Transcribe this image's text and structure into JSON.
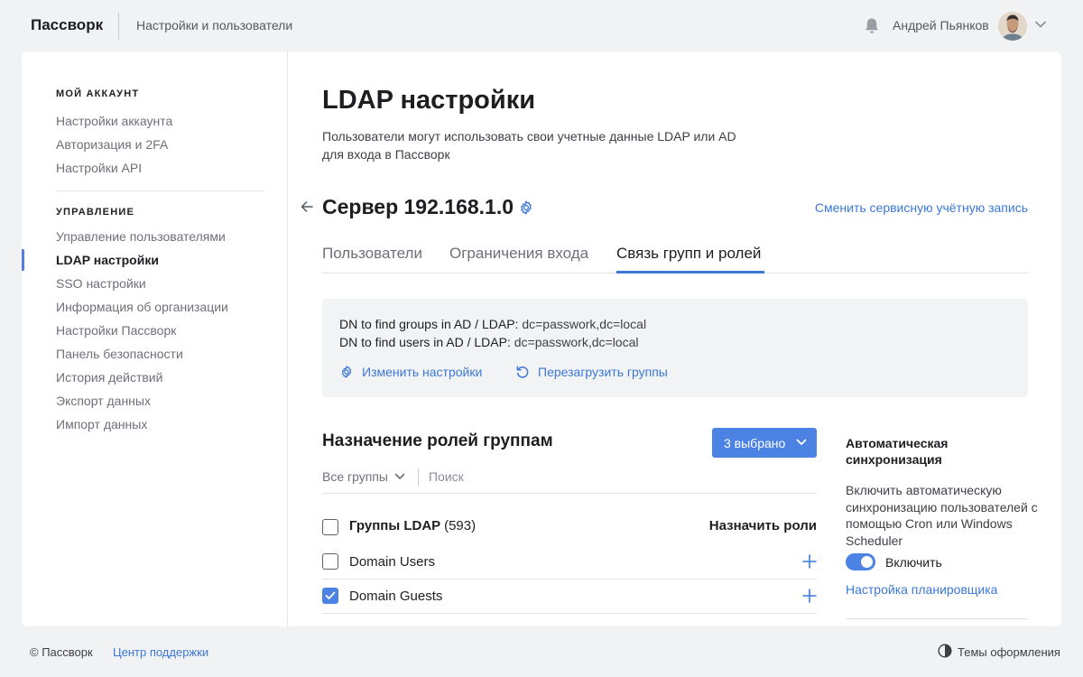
{
  "header": {
    "logo": "Пассворк",
    "section": "Настройки и пользователи",
    "user_name": "Андрей Пьянков"
  },
  "sidebar": {
    "groups": [
      {
        "title": "МОЙ АККАУНТ",
        "items": [
          "Настройки аккаунта",
          "Авторизация и 2FA",
          "Настройки API"
        ]
      },
      {
        "title": "УПРАВЛЕНИЕ",
        "items": [
          "Управление пользователями",
          "LDAP настройки",
          "SSO настройки",
          "Информация об организации",
          "Настройки Пассворк",
          "Панель безопасности",
          "История действий",
          "Экспорт данных",
          "Импорт данных"
        ]
      }
    ],
    "active_item": "LDAP настройки"
  },
  "main": {
    "title": "LDAP настройки",
    "description": "Пользователи могут использовать свои учетные данные LDAP или AD для входа в Пассворк",
    "server_title": "Сервер 192.168.1.0",
    "service_account_link": "Сменить сервисную учётную запись",
    "tabs": [
      {
        "label": "Пользователи",
        "active": false
      },
      {
        "label": "Ограничения входа",
        "active": false
      },
      {
        "label": "Связь групп и ролей",
        "active": true
      }
    ],
    "info": {
      "groups_dn_label": "DN to find groups in AD / LDAP:",
      "groups_dn_value": "dc=passwork,dc=local",
      "users_dn_label": "DN to find users in AD / LDAP:",
      "users_dn_value": "dc=passwork,dc=local",
      "edit_settings": "Изменить настройки",
      "reload_groups": "Перезагрузить группы"
    },
    "roles": {
      "title": "Назначение ролей группам",
      "selected_button": "3 выбрано",
      "filter_all_groups": "Все группы",
      "search_placeholder": "Поиск",
      "header_label": "Группы LDAP",
      "header_count": "(593)",
      "assign_label": "Назначить роли",
      "rows": [
        {
          "name": "Domain Users",
          "checked": false
        },
        {
          "name": "Domain Guests",
          "checked": true
        }
      ]
    },
    "sync": {
      "title": "Автоматическая синхронизация",
      "description": "Включить автоматическую синхронизацию пользователей с помощью Cron или Windows Scheduler",
      "toggle_label": "Включить",
      "toggle_on": true,
      "scheduler_link": "Настройка планировщика"
    }
  },
  "footer": {
    "copyright": "© Пассворк",
    "support": "Центр поддержки",
    "themes": "Темы оформления"
  },
  "colors": {
    "accent": "#4c82e4",
    "link": "#3b78d8",
    "background": "#f1f2f4"
  }
}
